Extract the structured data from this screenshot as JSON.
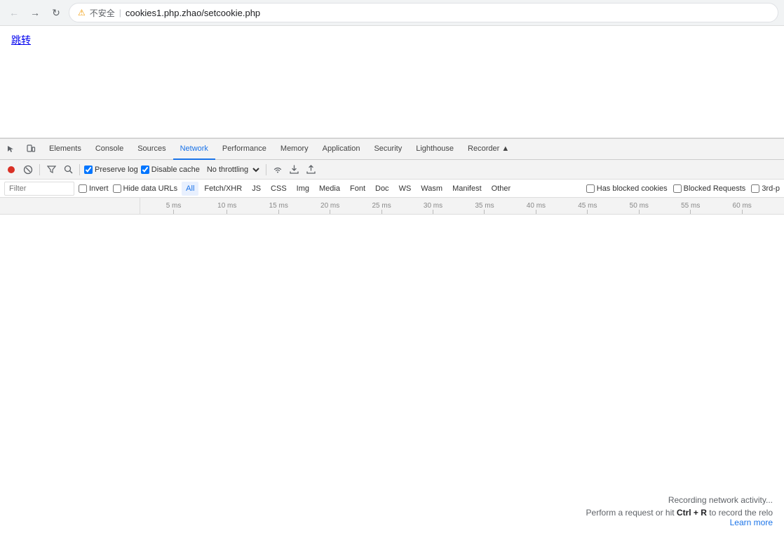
{
  "browser": {
    "back_btn": "←",
    "forward_btn": "→",
    "reload_btn": "↻",
    "warning_icon": "⚠",
    "insecure_label": "不安全",
    "separator": "|",
    "url": "cookies1.php.zhao/setcookie.php"
  },
  "page": {
    "link_text": "跳转"
  },
  "devtools": {
    "tabs": [
      {
        "id": "elements",
        "label": "Elements",
        "active": false
      },
      {
        "id": "console",
        "label": "Console",
        "active": false
      },
      {
        "id": "sources",
        "label": "Sources",
        "active": false
      },
      {
        "id": "network",
        "label": "Network",
        "active": true
      },
      {
        "id": "performance",
        "label": "Performance",
        "active": false
      },
      {
        "id": "memory",
        "label": "Memory",
        "active": false
      },
      {
        "id": "application",
        "label": "Application",
        "active": false
      },
      {
        "id": "security",
        "label": "Security",
        "active": false
      },
      {
        "id": "lighthouse",
        "label": "Lighthouse",
        "active": false
      },
      {
        "id": "recorder",
        "label": "Recorder ▲",
        "active": false
      }
    ],
    "toolbar": {
      "record_title": "Stop recording network log",
      "clear_title": "Clear",
      "filter_title": "Filter",
      "search_title": "Search",
      "preserve_log_label": "Preserve log",
      "preserve_log_checked": true,
      "disable_cache_label": "Disable cache",
      "disable_cache_checked": true,
      "throttle_label": "No throttling",
      "online_icon": "📶",
      "import_title": "Import HAR file",
      "export_title": "Export HAR"
    },
    "filter": {
      "placeholder": "Filter",
      "invert_label": "Invert",
      "hide_data_urls_label": "Hide data URLs",
      "type_buttons": [
        "All",
        "Fetch/XHR",
        "JS",
        "CSS",
        "Img",
        "Media",
        "Font",
        "Doc",
        "WS",
        "Wasm",
        "Manifest",
        "Other"
      ],
      "active_type": "All",
      "has_blocked_cookies_label": "Has blocked cookies",
      "blocked_requests_label": "Blocked Requests",
      "third_party_label": "3rd-p"
    },
    "timeline": {
      "ticks": [
        {
          "label": "5 ms",
          "pct": 4
        },
        {
          "label": "10 ms",
          "pct": 12
        },
        {
          "label": "15 ms",
          "pct": 20
        },
        {
          "label": "20 ms",
          "pct": 28
        },
        {
          "label": "25 ms",
          "pct": 36
        },
        {
          "label": "30 ms",
          "pct": 44
        },
        {
          "label": "35 ms",
          "pct": 52
        },
        {
          "label": "40 ms",
          "pct": 60
        },
        {
          "label": "45 ms",
          "pct": 68
        },
        {
          "label": "50 ms",
          "pct": 76
        },
        {
          "label": "55 ms",
          "pct": 84
        },
        {
          "label": "60 ms",
          "pct": 92
        }
      ]
    },
    "empty_state": {
      "recording": "Recording network activity...",
      "perform": "Perform a request or hit",
      "shortcut": "Ctrl + R",
      "perform2": "to record the relo",
      "learn_more": "Learn more"
    }
  }
}
